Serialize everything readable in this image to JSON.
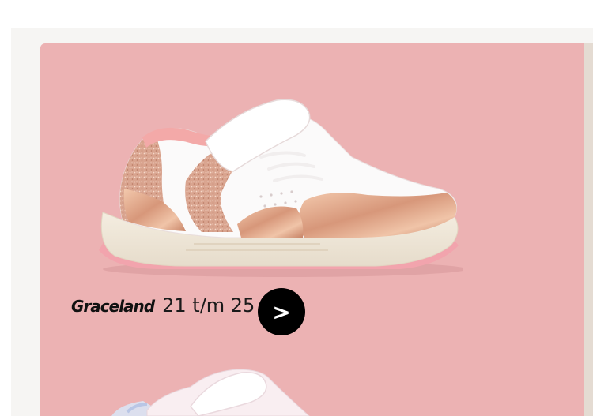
{
  "product": {
    "brand": "Graceland",
    "sizes": "21 t/m 25",
    "image_alt": "pink rose-gold glitter kids sneaker",
    "cta_glyph": ">"
  },
  "colors": {
    "card_background": "#ecb2b3",
    "page_background": "#ffffff",
    "side_band": "#f6f5f3",
    "next_card": "#e4dbd2",
    "button": "#000000",
    "button_text": "#ffffff"
  },
  "icons": {
    "cta": "chevron-right-icon"
  }
}
